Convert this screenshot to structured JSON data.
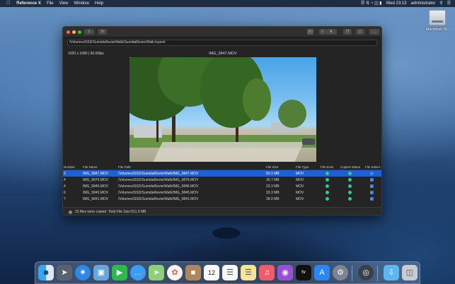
{
  "menubar": {
    "apple": "",
    "app": "Reference X",
    "menus": [
      "File",
      "View",
      "Window",
      "Help"
    ],
    "clock": "Wed 23:13",
    "user": "administrator"
  },
  "desktop": {
    "disk_label": "Macintosh HD"
  },
  "window": {
    "path": "/Volumes/SSD/SumidaRevierWalk/SumidaRevierWalk.fcpxml",
    "resolution": "1920 x 1080 | 60.00fps",
    "preview_title": "IMG_5847.MOV",
    "table": {
      "headers": [
        "Number",
        "File Name",
        "File Path",
        "File Size",
        "File Type",
        "File Exist",
        "Copied Status",
        "File Select"
      ],
      "rows": [
        {
          "num": "3",
          "name": "IMG_5847.MOV",
          "path": "/Volumes/SSD/SumidaRevierWalk/IMG_5847.MOV",
          "size": "50.1 MB",
          "type": "MOV",
          "selected": true
        },
        {
          "num": "4",
          "name": "IMG_5876.MOV",
          "path": "/Volumes/SSD/SumidaRevierWalk/IMG_5876.MOV",
          "size": "30.7 MB",
          "type": "MOV",
          "selected": false
        },
        {
          "num": "4",
          "name": "IMG_5846.MOV",
          "path": "/Volumes/SSD/SumidaRevierWalk/IMG_5846.MOV",
          "size": "23.3 MB",
          "type": "MOV",
          "selected": false
        },
        {
          "num": "6",
          "name": "IMG_5845.MOV",
          "path": "/Volumes/SSD/SumidaRevierWalk/IMG_5845.MOV",
          "size": "33.3 MB",
          "type": "MOV",
          "selected": false
        },
        {
          "num": "7",
          "name": "IMG_5841.MOV",
          "path": "/Volumes/SSD/SumidaRevierWalk/IMG_5841.MOV",
          "size": "28.0 MB",
          "type": "MOV",
          "selected": false
        }
      ]
    },
    "status": "15 files were copied.   Total File Size:511.0 MB",
    "colors": {
      "selection": "#1d5fd6",
      "exist_dot": "#39c59b",
      "checkbox": "#2f7bf5"
    }
  },
  "dock": {
    "apps": [
      "finder-icon",
      "launchpad-icon",
      "safari-icon",
      "preview-icon",
      "facetime-icon",
      "messages-icon",
      "maps-icon",
      "photos-icon",
      "contacts-icon",
      "calendar-icon",
      "reminders-icon",
      "notes-icon",
      "music-icon",
      "podcasts-icon",
      "tv-icon",
      "appstore-icon",
      "settings-icon",
      "referencex-icon",
      "downloads-folder-icon",
      "trash-icon"
    ],
    "calendar_day": "12",
    "tv_label": "tv"
  }
}
